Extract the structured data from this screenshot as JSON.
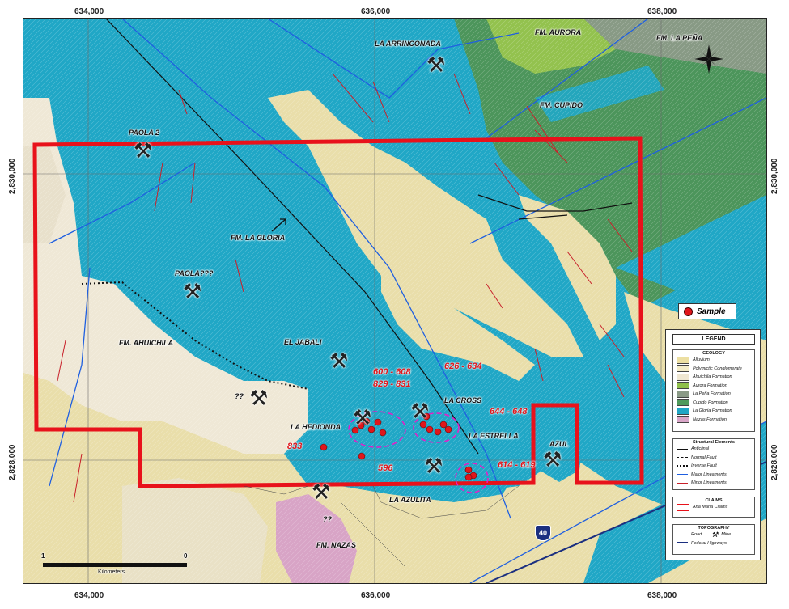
{
  "axes": {
    "top_ticks": [
      "634,000",
      "636,000",
      "638,000"
    ],
    "bottom_ticks": [
      "634,000",
      "636,000",
      "638,000"
    ],
    "left_ticks": [
      "2,830,000",
      "2,828,000"
    ],
    "right_ticks": [
      "2,830,000",
      "2,828,000"
    ]
  },
  "formations": [
    {
      "id": "aurora",
      "text": "FM. AURORA"
    },
    {
      "id": "la-pena",
      "text": "FM. LA PEÑA"
    },
    {
      "id": "cupido",
      "text": "FM. CUPIDO"
    },
    {
      "id": "la-gloria",
      "text": "FM. LA GLORIA"
    },
    {
      "id": "ahuichila",
      "text": "FM. AHUICHILA"
    },
    {
      "id": "nazas",
      "text": "FM. NAZAS"
    }
  ],
  "mine_sites": [
    {
      "id": "la-arrinconada",
      "text": "LA ARRINCONADA"
    },
    {
      "id": "paola-2",
      "text": "PAOLA 2"
    },
    {
      "id": "paola-q",
      "text": "PAOLA???"
    },
    {
      "id": "el-jabali",
      "text": "EL JABALI"
    },
    {
      "id": "unknown-1",
      "text": "??"
    },
    {
      "id": "la-hedionda",
      "text": "LA HEDIONDA"
    },
    {
      "id": "la-cross",
      "text": "LA CROSS"
    },
    {
      "id": "la-estrella",
      "text": "LA ESTRELLA"
    },
    {
      "id": "azul",
      "text": "AZUL"
    },
    {
      "id": "la-azulita",
      "text": "LA AZULITA"
    },
    {
      "id": "unknown-2",
      "text": "??"
    }
  ],
  "sample_codes": [
    {
      "id": "s600",
      "text": "600 - 608"
    },
    {
      "id": "s829",
      "text": "829 - 831"
    },
    {
      "id": "s626",
      "text": "626 - 634"
    },
    {
      "id": "s644",
      "text": "644 - 648"
    },
    {
      "id": "s833",
      "text": "833"
    },
    {
      "id": "s596",
      "text": "596"
    },
    {
      "id": "s614",
      "text": "614 - 619"
    }
  ],
  "highway_shield": "40",
  "scale_bar": {
    "left": "1",
    "right": "0",
    "unit": "Kilometers"
  },
  "sample_key": "Sample",
  "legend": {
    "title": "LEGEND",
    "geology_title": "GEOLOGY",
    "geology": [
      {
        "label": "Alluvium",
        "color": "#ecdfa2"
      },
      {
        "label": "Polymictic Conglomerate",
        "color": "#f3ecc9"
      },
      {
        "label": "Ahuichila Formation",
        "color": "#efe7d2"
      },
      {
        "label": "Aurora Formation",
        "color": "#8fc04a"
      },
      {
        "label": "La Peña Formation",
        "color": "#8a9a86"
      },
      {
        "label": "Cupido Formation",
        "color": "#4f9a5b"
      },
      {
        "label": "La Gloria Formation",
        "color": "#1fa6c4"
      },
      {
        "label": "Nazas Formation",
        "color": "#d9a6c8"
      }
    ],
    "structural_title": "Structural Elements",
    "structural": [
      {
        "label": "Anticlinal"
      },
      {
        "label": "Normal Fault"
      },
      {
        "label": "Inverse Fault"
      },
      {
        "label": "Major Lineaments"
      },
      {
        "label": "Minor Lineaments"
      }
    ],
    "claims_title": "CLAIMS",
    "claims_label": "Ana Maria Claims",
    "topography_title": "TOPOGRAPHY",
    "road_label": "Road",
    "mine_label": "Mine",
    "highway_label": "Federal Highways"
  },
  "colors": {
    "claim_boundary": "#e8121b",
    "sample": "#e0161b",
    "sample_zone": "#e020c8",
    "major_lineament": "#1f5fe0",
    "minor_lineament": "#c8202a"
  }
}
